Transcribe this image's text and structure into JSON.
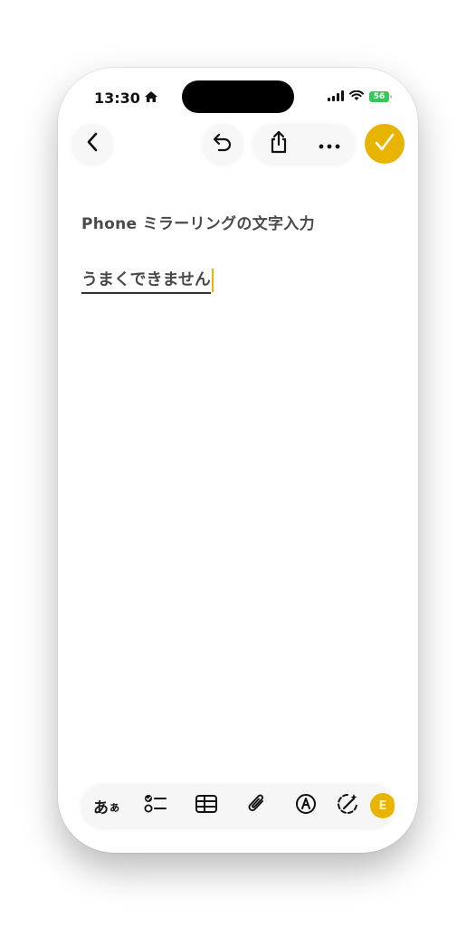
{
  "status_bar": {
    "time": "13:30",
    "battery_level": "56",
    "icons": [
      "home-icon",
      "signal-icon",
      "wifi-icon",
      "battery-icon"
    ]
  },
  "nav": {
    "icons": [
      "chevron-left-icon",
      "undo-icon",
      "share-icon",
      "more-icon",
      "checkmark-icon"
    ],
    "accent_color": "#e8b400"
  },
  "note": {
    "title": "Phone ミラーリングの文字入力",
    "body_marked": "うまくできません"
  },
  "toolbar": {
    "format_label": "あ",
    "format_label_small": "ぁ",
    "avatar_letter": "E",
    "icons": [
      "format-icon",
      "checklist-icon",
      "table-icon",
      "paperclip-icon",
      "markup-icon",
      "writing-tools-icon",
      "avatar"
    ]
  },
  "colors": {
    "accent": "#e8b400",
    "battery": "#34c759",
    "text": "#4a4a4a"
  }
}
